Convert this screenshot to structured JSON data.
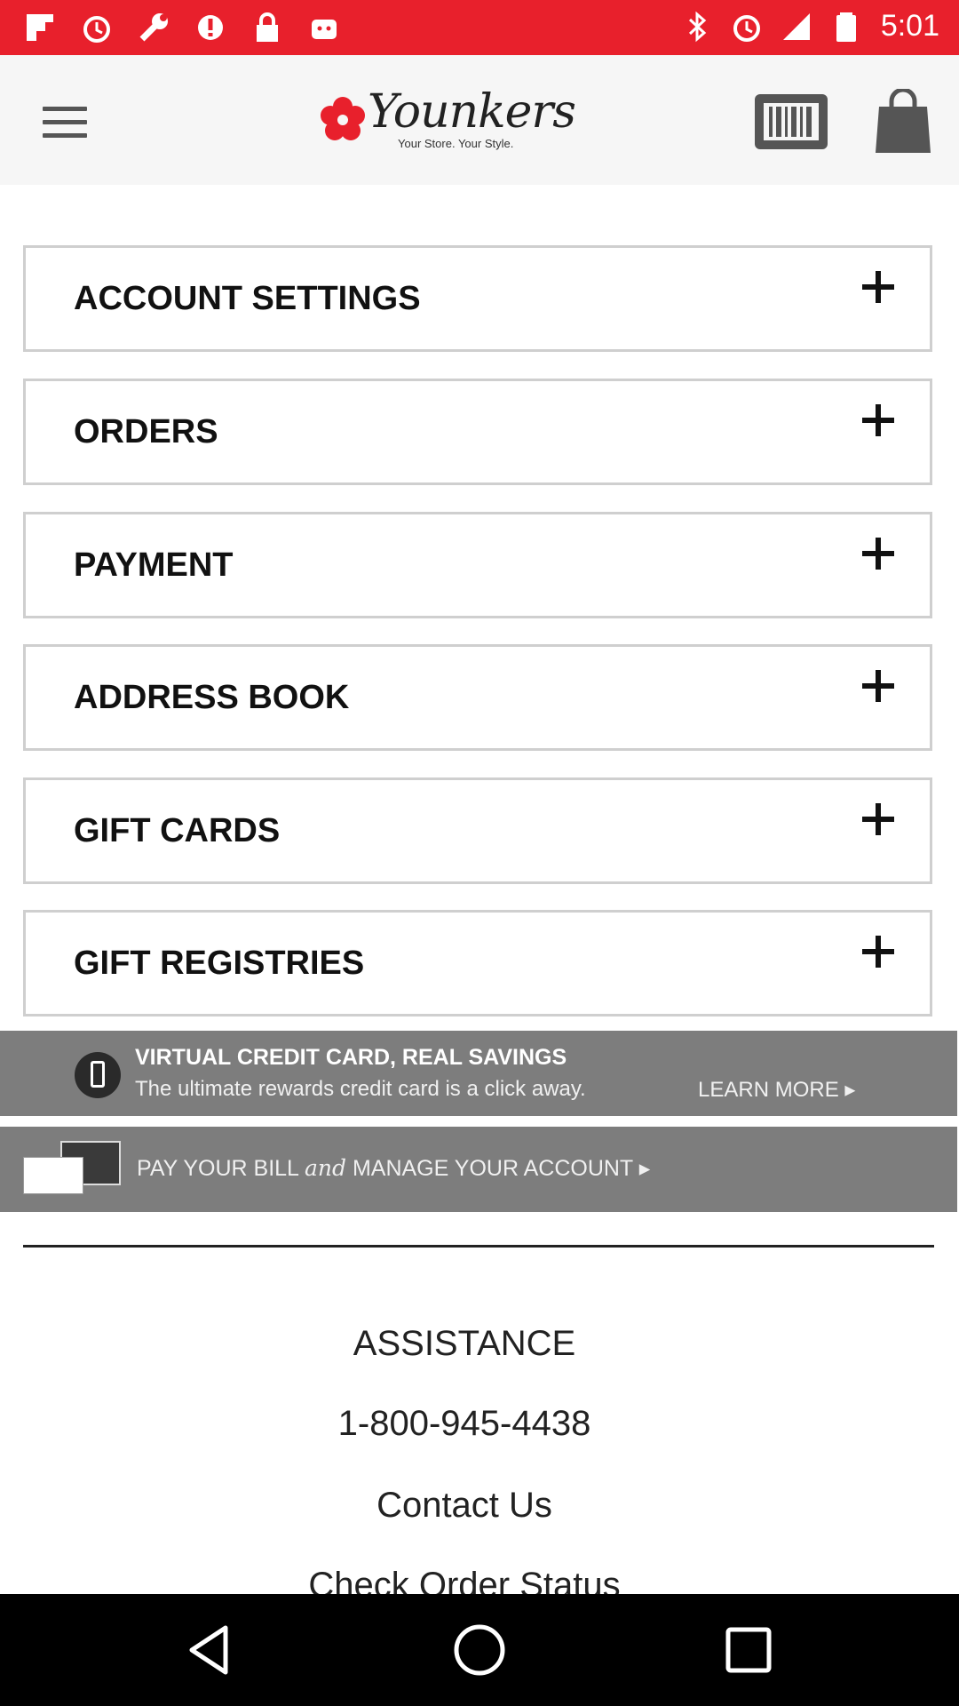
{
  "status_bar": {
    "time": "5:01",
    "left_icons": [
      "flipboard-icon",
      "alarm-icon",
      "wrench-icon",
      "warning-icon",
      "lock-icon",
      "android-icon"
    ],
    "right_icons": [
      "bluetooth-icon",
      "alarm-icon",
      "signal-icon",
      "battery-icon"
    ]
  },
  "header": {
    "brand_name": "Younkers",
    "brand_tagline": "Your Store. Your Style.",
    "brand_color": "#e8202c"
  },
  "menu_items": [
    {
      "label": "ACCOUNT SETTINGS"
    },
    {
      "label": "ORDERS"
    },
    {
      "label": "PAYMENT"
    },
    {
      "label": "ADDRESS BOOK"
    },
    {
      "label": "GIFT CARDS"
    },
    {
      "label": "GIFT REGISTRIES"
    }
  ],
  "banners": {
    "credit": {
      "title": "VIRTUAL CREDIT CARD, REAL SAVINGS",
      "subtitle": "The ultimate rewards credit card is a click away.",
      "cta": "LEARN MORE"
    },
    "bill": {
      "text_before": "PAY YOUR BILL",
      "text_and": "and",
      "text_after": "MANAGE YOUR ACCOUNT"
    }
  },
  "footer": {
    "assistance": "ASSISTANCE",
    "phone": "1-800-945-4438",
    "contact": "Contact Us",
    "check_order": "Check Order Status"
  }
}
